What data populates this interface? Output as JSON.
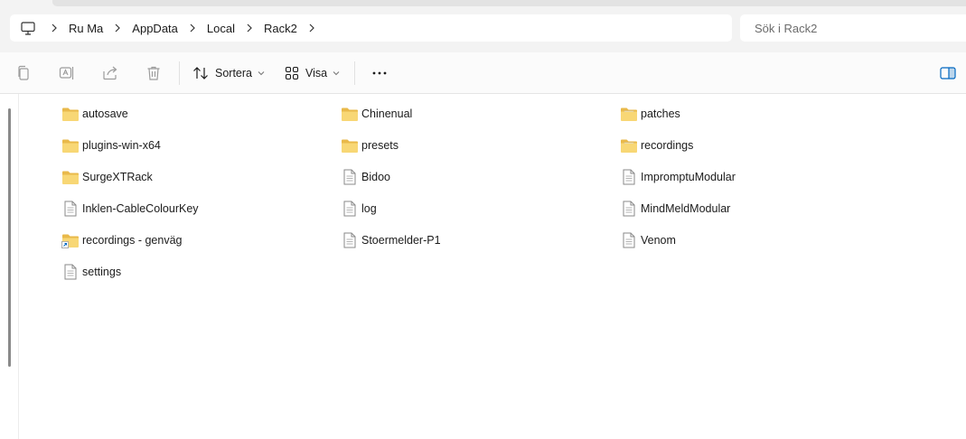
{
  "breadcrumb": {
    "items": [
      "Ru Ma",
      "AppData",
      "Local",
      "Rack2"
    ]
  },
  "search": {
    "placeholder": "Sök i Rack2"
  },
  "toolbar": {
    "sort_label": "Sortera",
    "view_label": "Visa",
    "more_label": "···"
  },
  "files": [
    {
      "name": "autosave",
      "type": "folder"
    },
    {
      "name": "plugins-win-x64",
      "type": "folder"
    },
    {
      "name": "SurgeXTRack",
      "type": "folder"
    },
    {
      "name": "Inklen-CableColourKey",
      "type": "file"
    },
    {
      "name": "recordings - genväg",
      "type": "shortcut"
    },
    {
      "name": "settings",
      "type": "file"
    },
    {
      "name": "Chinenual",
      "type": "folder"
    },
    {
      "name": "presets",
      "type": "folder"
    },
    {
      "name": "Bidoo",
      "type": "file"
    },
    {
      "name": "log",
      "type": "file"
    },
    {
      "name": "Stoermelder-P1",
      "type": "file"
    },
    {
      "name": "patches",
      "type": "folder-content"
    },
    {
      "name": "recordings",
      "type": "folder-content"
    },
    {
      "name": "ImpromptuModular",
      "type": "file"
    },
    {
      "name": "MindMeldModular",
      "type": "file"
    },
    {
      "name": "Venom",
      "type": "file"
    }
  ],
  "colors": {
    "folder": "#f8d775",
    "folder_dark": "#e9b94a",
    "accent": "#0067c0"
  }
}
